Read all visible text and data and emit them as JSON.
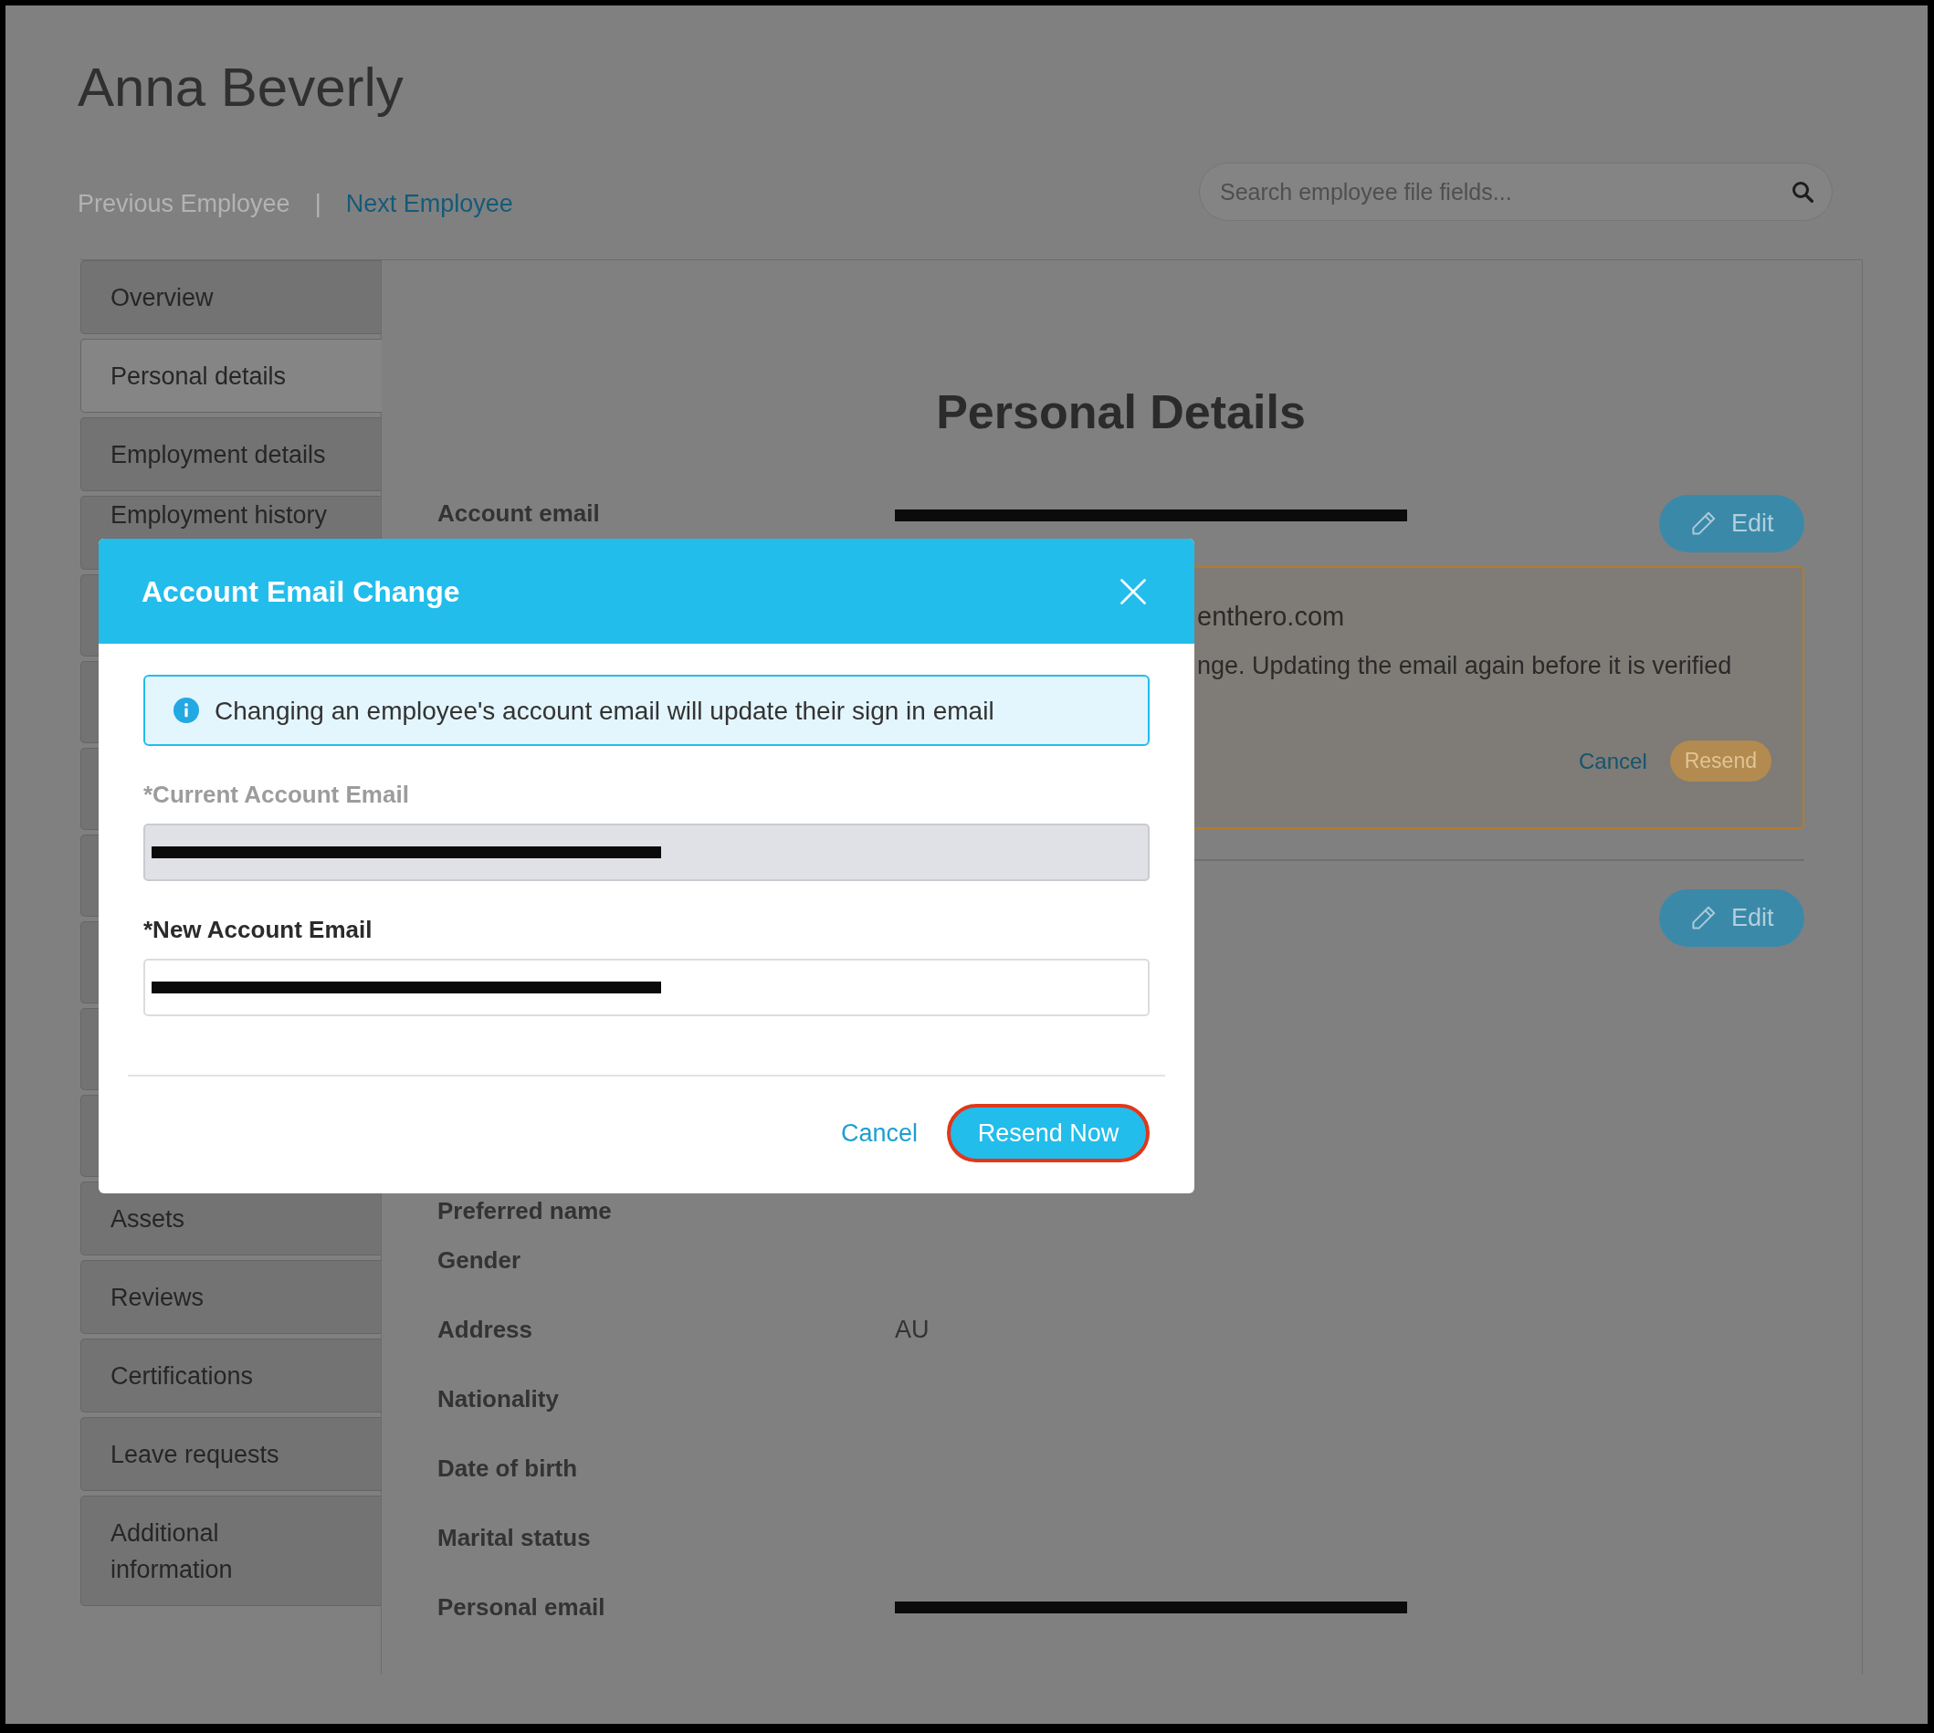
{
  "employee": {
    "name": "Anna Beverly"
  },
  "navigation": [
    {
      "kind": "link",
      "label": "Previous Employee",
      "disabled": true
    },
    {
      "kind": "separator",
      "label": "|"
    },
    {
      "kind": "link",
      "label": "Next Employee",
      "disabled": false
    }
  ],
  "search": {
    "placeholder": "Search employee file fields..."
  },
  "sidebar": {
    "items": [
      {
        "label": "Overview",
        "selected": false
      },
      {
        "label": "Personal details",
        "selected": true
      },
      {
        "label": "Employment details",
        "selected": false
      },
      {
        "label": "Employment history",
        "selected": false
      },
      {
        "selected": false
      },
      {
        "selected": false
      },
      {
        "selected": false
      },
      {
        "selected": false
      },
      {
        "selected": false
      },
      {
        "selected": false
      },
      {
        "selected": false
      },
      {
        "label": "Assets",
        "selected": false
      },
      {
        "label": "Reviews",
        "selected": false
      },
      {
        "label": "Certifications",
        "selected": false
      },
      {
        "label": "Leave requests",
        "selected": false
      },
      {
        "label": "Additional information",
        "selected": false
      }
    ]
  },
  "section": {
    "title": "Personal Details",
    "account_email": {
      "label": "Account email",
      "redacted": true,
      "edit_button": "Edit"
    },
    "pending_change": {
      "email": "enthero.com",
      "message": "nge. Updating the email again before it is verified",
      "cancel": "Cancel",
      "resend": "Resend"
    },
    "second_block": {
      "edit_button": "Edit"
    },
    "fields": [
      {
        "label": "Preferred name"
      },
      {
        "label": "Gender"
      },
      {
        "label": "Address",
        "value": "AU"
      },
      {
        "label": "Nationality"
      },
      {
        "label": "Date of birth"
      },
      {
        "label": "Marital status"
      },
      {
        "label": "Personal email",
        "redacted": true
      }
    ]
  },
  "modal": {
    "title": "Account Email Change",
    "notice": "Changing an employee's account email will update their sign in email",
    "fields": [
      {
        "label": "*Current Account Email",
        "disabled": true,
        "redacted": true
      },
      {
        "label": "*New Account Email",
        "disabled": false,
        "redacted": true
      }
    ],
    "buttons": [
      {
        "kind": "link",
        "label": "Cancel",
        "highlighted": false
      },
      {
        "kind": "primary",
        "label": "Resend Now",
        "highlighted": true
      }
    ]
  }
}
